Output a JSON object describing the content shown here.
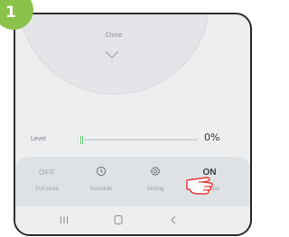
{
  "step_badge": "1",
  "header": {
    "close_label": "Close"
  },
  "level": {
    "label": "Level",
    "value_text": "0%",
    "slider_value": 0
  },
  "controls": [
    {
      "key": "full_close",
      "icon_text": "OFF",
      "label": "Full close",
      "icon": "off-icon"
    },
    {
      "key": "schedule",
      "icon_text": "",
      "label": "Schedule",
      "icon": "clock-icon"
    },
    {
      "key": "setting",
      "icon_text": "",
      "label": "Setting",
      "icon": "gear-icon"
    },
    {
      "key": "full_open",
      "icon_text": "ON",
      "label": "Full ope",
      "icon": "on-icon"
    }
  ],
  "navbar": {
    "recent": "recents-icon",
    "home": "home-icon",
    "back": "back-icon"
  },
  "colors": {
    "badge": "#8bc34a",
    "slider_accent": "#62c370"
  }
}
